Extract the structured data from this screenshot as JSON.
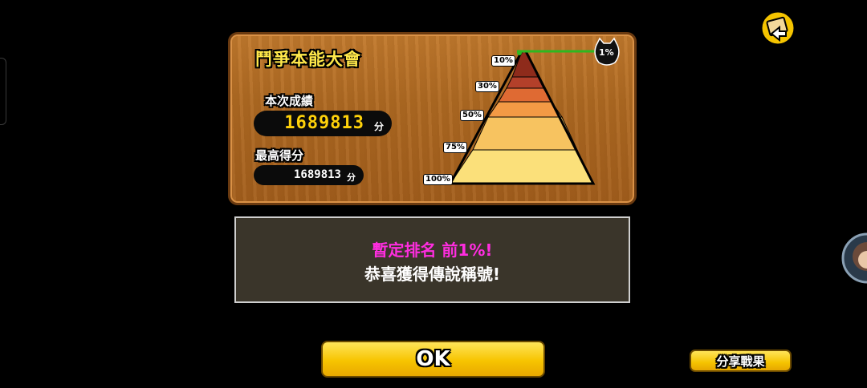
{
  "event_title": "鬥爭本能大會",
  "current_score": {
    "label": "本次成績",
    "value": "1689813",
    "unit": "分"
  },
  "best_score": {
    "label": "最高得分",
    "value": "1689813",
    "unit": "分"
  },
  "pyramid": {
    "tiers": [
      "10%",
      "30%",
      "50%",
      "75%",
      "100%"
    ],
    "player_rank_badge": "1%",
    "tier_colors": [
      "#8e2b1b",
      "#b3402a",
      "#df6a33",
      "#f39a45",
      "#f7c360",
      "#fbe07a"
    ]
  },
  "message": {
    "rank_line": "暫定排名 前1%!",
    "congrats_line": "恭喜獲得傳說稱號!"
  },
  "buttons": {
    "ok": "OK",
    "share": "分享戰果"
  },
  "icons": {
    "back": "back-arrow-icon",
    "cat": "cat-head-icon",
    "avatar": "player-avatar"
  }
}
